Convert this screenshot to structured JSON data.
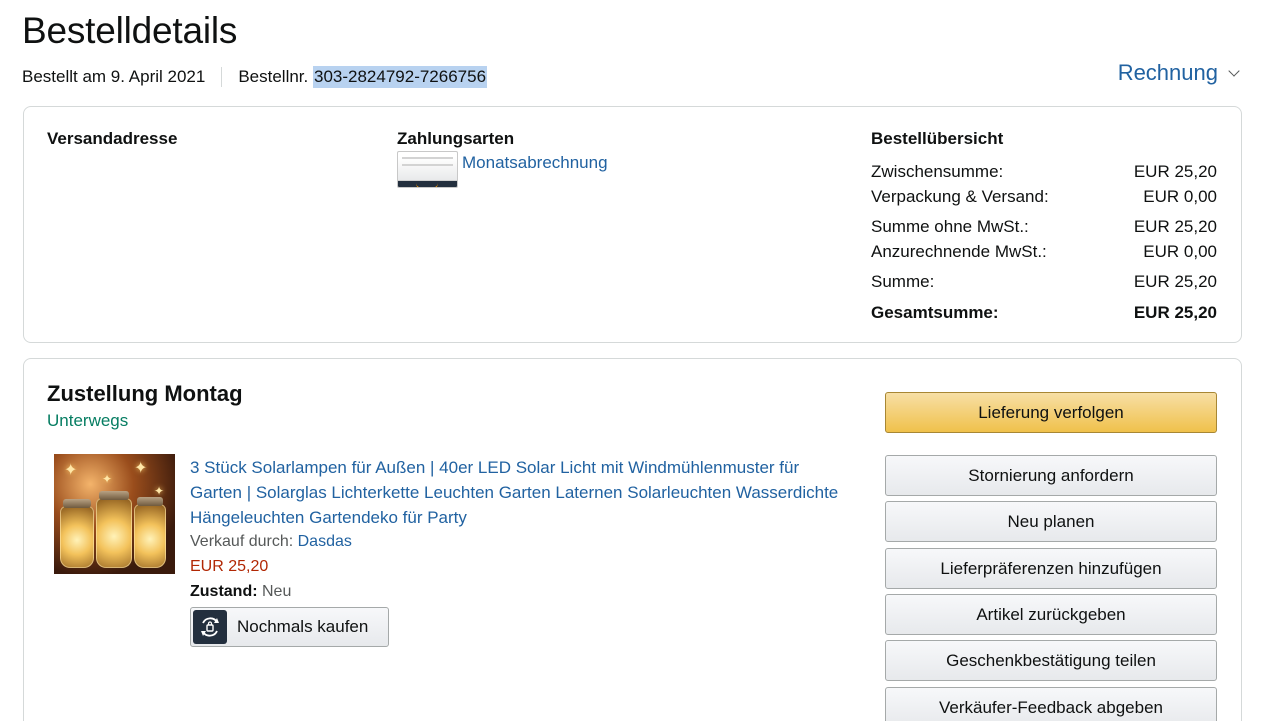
{
  "header": {
    "title": "Bestelldetails",
    "ordered_on": "Bestellt am 9. April 2021",
    "order_number_label": "Bestellnr. ",
    "order_number": "303-2824792-7266756",
    "invoice_label": "Rechnung"
  },
  "order_info": {
    "shipping_address_label": "Versandadresse",
    "payment_label": "Zahlungsarten",
    "payment_method": "Monatsabrechnung",
    "summary_label": "Bestellübersicht",
    "summary_rows": [
      {
        "label": "Zwischensumme:",
        "value": "EUR 25,20"
      },
      {
        "label": "Verpackung & Versand:",
        "value": "EUR 0,00"
      },
      {
        "label": "Summe ohne MwSt.:",
        "value": "EUR 25,20"
      },
      {
        "label": "Anzurechnende MwSt.:",
        "value": "EUR 0,00"
      },
      {
        "label": "Summe:",
        "value": "EUR 25,20"
      },
      {
        "label": "Gesamtsumme:",
        "value": "EUR 25,20"
      }
    ]
  },
  "shipment": {
    "title": "Zustellung Montag",
    "status": "Unterwegs",
    "status_color": "#067d62",
    "item": {
      "title": "3 Stück Solarlampen für Außen | 40er LED Solar Licht mit Windmühlenmuster für Garten | Solarglas Lichterkette Leuchten Garten Laternen Solarleuchten Wasserdichte Hängeleuchten Gartendeko für Party",
      "sold_by_label": "Verkauf durch: ",
      "seller": "Dasdas",
      "price": "EUR 25,20",
      "condition_label": "Zustand:",
      "condition": " Neu",
      "buy_again_label": "Nochmals kaufen"
    },
    "actions": [
      {
        "label": "Lieferung verfolgen",
        "primary": true
      },
      {
        "label": "Stornierung anfordern"
      },
      {
        "label": "Neu planen"
      },
      {
        "label": "Lieferpräferenzen hinzufügen"
      },
      {
        "label": "Artikel zurückgeben"
      },
      {
        "label": "Geschenkbestätigung teilen"
      },
      {
        "label": "Verkäufer-Feedback abgeben"
      }
    ]
  },
  "colors": {
    "link": "#2162a1",
    "price": "#b12704",
    "primary_button": "#f0c14b",
    "highlight": "#b8d2f0"
  }
}
